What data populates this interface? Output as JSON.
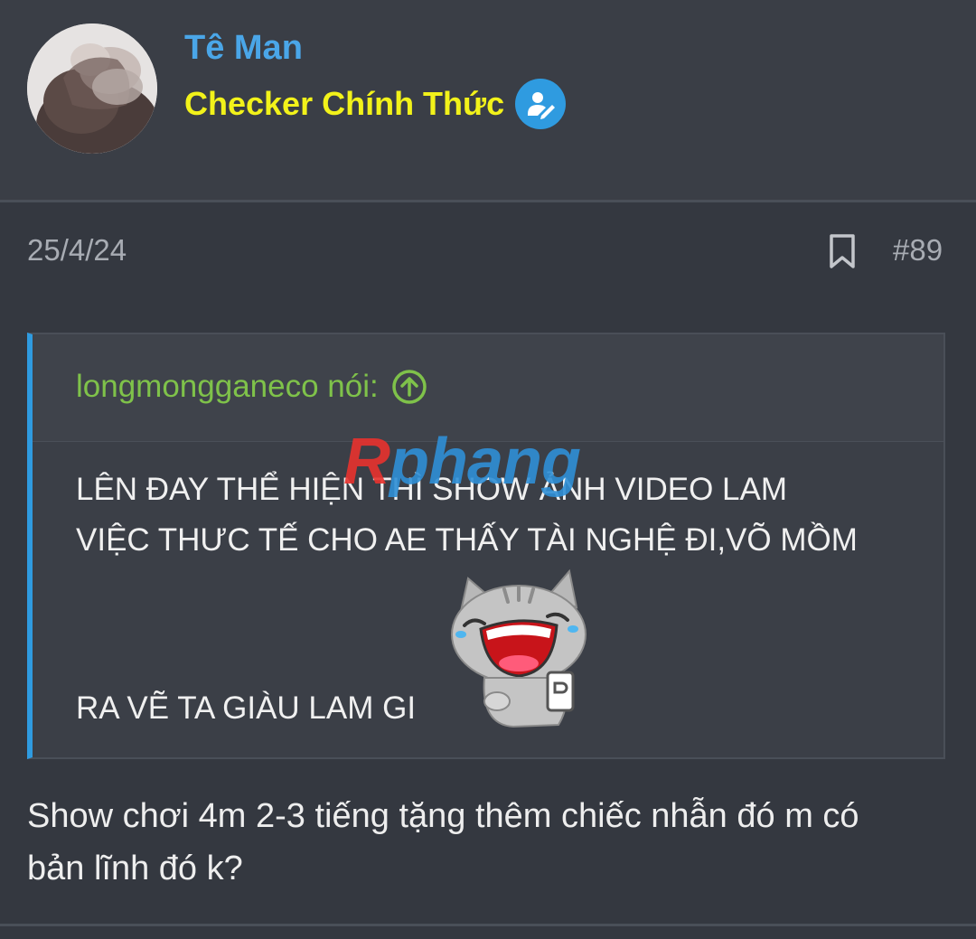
{
  "user": {
    "name": "Tê Man",
    "title": "Checker Chính Thức"
  },
  "post": {
    "date": "25/4/24",
    "number": "#89"
  },
  "quote": {
    "author": "longmongganeco nói:",
    "lines": [
      "LÊN ĐAY THỂ HIỆN THÌ SHOW ẢNH VIDEO LAM",
      "VIỆC THƯC TẾ CHO AE THẤY TÀI NGHỆ ĐI,VÕ MỒM",
      "RA VẼ TA GIÀU LAM GI"
    ]
  },
  "reply": {
    "lines": [
      "Show chơi 4m 2-3 tiếng tặng thêm chiếc nhẫn đó m có",
      "bản lĩnh đó k?"
    ]
  },
  "watermark": {
    "first": "R",
    "rest": "phang"
  },
  "icons": {
    "verified": "verified-checker-icon",
    "bookmark": "bookmark-icon",
    "quote_jump": "arrow-up-circle-icon",
    "sticker": "laughing-cat-sticker"
  },
  "colors": {
    "background": "#343840",
    "username": "#4aa6e8",
    "user_title": "#f2f21a",
    "badge": "#2f9be0",
    "quote_author": "#7fc24a",
    "quote_accent": "#2f9be0"
  }
}
